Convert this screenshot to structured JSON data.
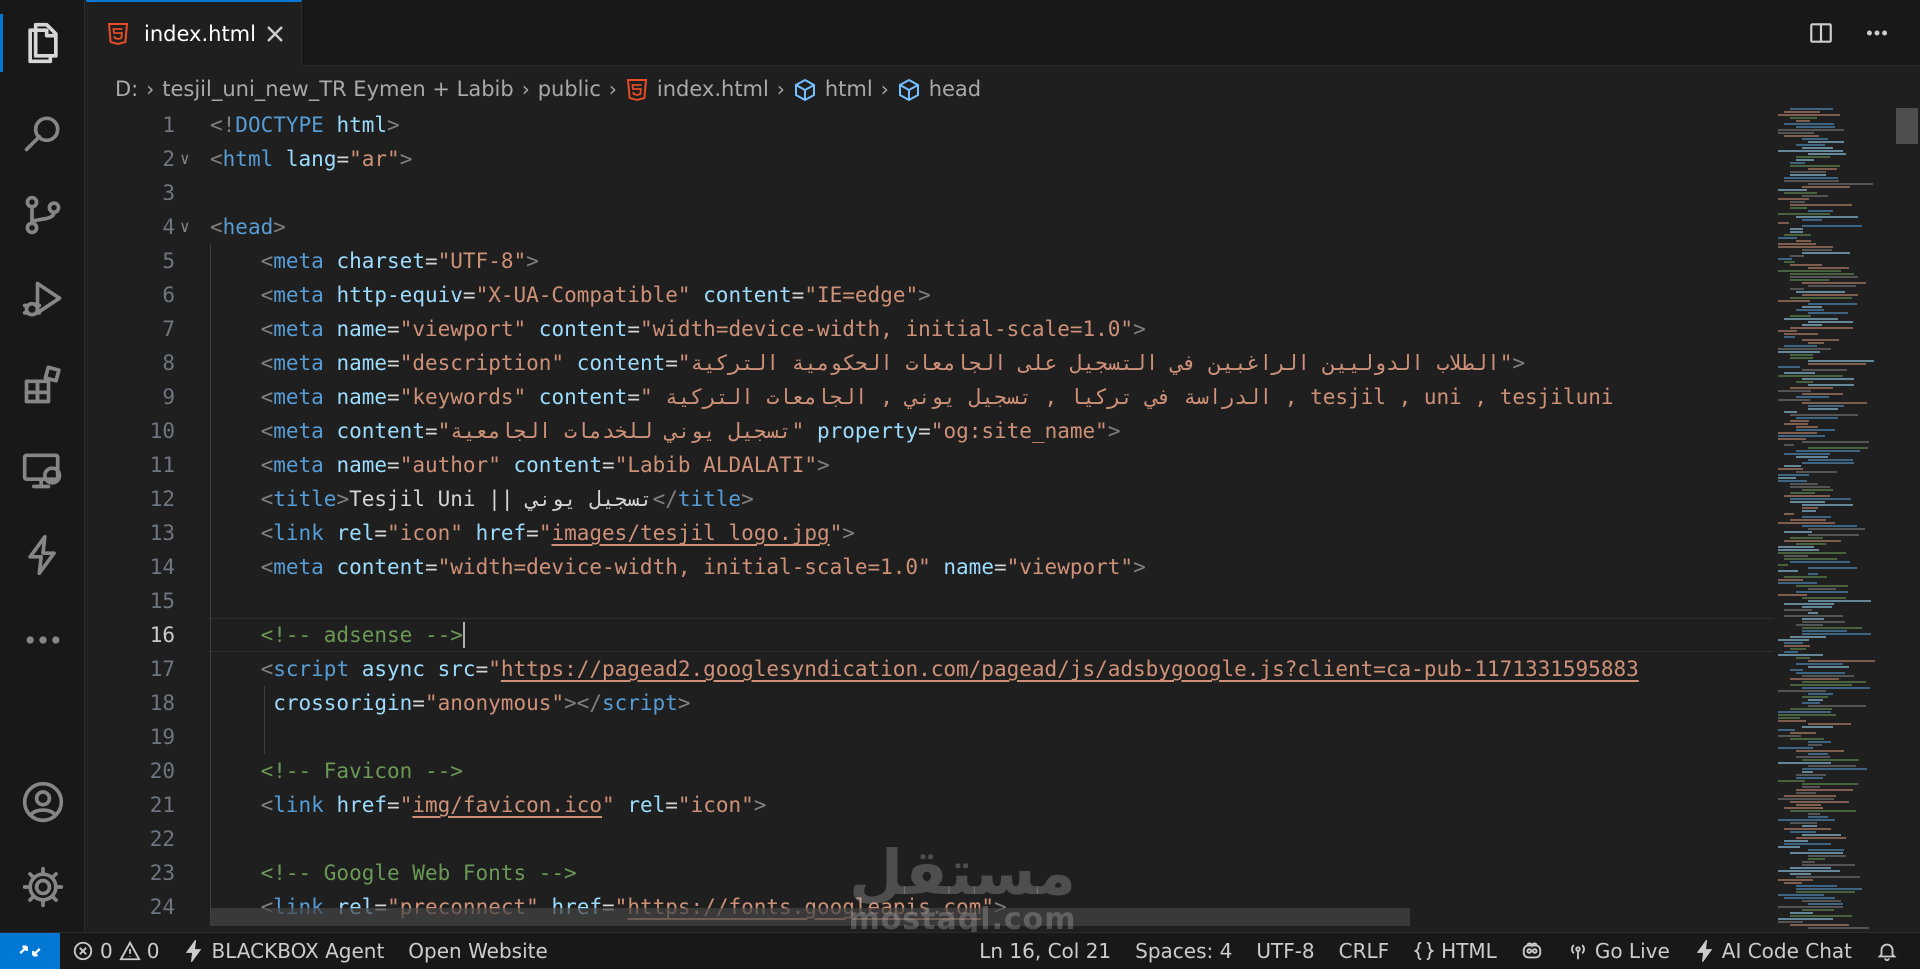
{
  "tab": {
    "label": "index.html"
  },
  "breadcrumb": {
    "items": [
      "D:",
      "tesjil_uni_new_TR Eymen + Labib",
      "public",
      "index.html",
      "html",
      "head"
    ]
  },
  "editor": {
    "current_line": 16,
    "lines": [
      {
        "n": "1",
        "tokens": [
          [
            "p",
            "<!"
          ],
          [
            "t",
            "DOCTYPE"
          ],
          [
            "d",
            " "
          ],
          [
            "a",
            "html"
          ],
          [
            "p",
            ">"
          ]
        ]
      },
      {
        "n": "2",
        "tokens": [
          [
            "p",
            "<"
          ],
          [
            "t",
            "html"
          ],
          [
            "d",
            " "
          ],
          [
            "a",
            "lang"
          ],
          [
            "d",
            "="
          ],
          [
            "s",
            "\"ar\""
          ],
          [
            "p",
            ">"
          ]
        ]
      },
      {
        "n": "3",
        "tokens": []
      },
      {
        "n": "4",
        "tokens": [
          [
            "p",
            "<"
          ],
          [
            "t",
            "head"
          ],
          [
            "p",
            ">"
          ]
        ]
      },
      {
        "n": "5",
        "tokens": [
          [
            "d",
            "    "
          ],
          [
            "p",
            "<"
          ],
          [
            "t",
            "meta"
          ],
          [
            "d",
            " "
          ],
          [
            "a",
            "charset"
          ],
          [
            "d",
            "="
          ],
          [
            "s",
            "\"UTF-8\""
          ],
          [
            "p",
            ">"
          ]
        ]
      },
      {
        "n": "6",
        "tokens": [
          [
            "d",
            "    "
          ],
          [
            "p",
            "<"
          ],
          [
            "t",
            "meta"
          ],
          [
            "d",
            " "
          ],
          [
            "a",
            "http-equiv"
          ],
          [
            "d",
            "="
          ],
          [
            "s",
            "\"X-UA-Compatible\""
          ],
          [
            "d",
            " "
          ],
          [
            "a",
            "content"
          ],
          [
            "d",
            "="
          ],
          [
            "s",
            "\"IE=edge\""
          ],
          [
            "p",
            ">"
          ]
        ]
      },
      {
        "n": "7",
        "tokens": [
          [
            "d",
            "    "
          ],
          [
            "p",
            "<"
          ],
          [
            "t",
            "meta"
          ],
          [
            "d",
            " "
          ],
          [
            "a",
            "name"
          ],
          [
            "d",
            "="
          ],
          [
            "s",
            "\"viewport\""
          ],
          [
            "d",
            " "
          ],
          [
            "a",
            "content"
          ],
          [
            "d",
            "="
          ],
          [
            "s",
            "\"width=device-width, initial-scale=1.0\""
          ],
          [
            "p",
            ">"
          ]
        ]
      },
      {
        "n": "8",
        "tokens": [
          [
            "d",
            "    "
          ],
          [
            "p",
            "<"
          ],
          [
            "t",
            "meta"
          ],
          [
            "d",
            " "
          ],
          [
            "a",
            "name"
          ],
          [
            "d",
            "="
          ],
          [
            "s",
            "\"description\""
          ],
          [
            "d",
            " "
          ],
          [
            "a",
            "content"
          ],
          [
            "d",
            "="
          ],
          [
            "s",
            "\"الطلاب الدوليين الراغبين في التسجيل على الجامعات الحكومية التركية\""
          ],
          [
            "p",
            ">"
          ]
        ]
      },
      {
        "n": "9",
        "tokens": [
          [
            "d",
            "    "
          ],
          [
            "p",
            "<"
          ],
          [
            "t",
            "meta"
          ],
          [
            "d",
            " "
          ],
          [
            "a",
            "name"
          ],
          [
            "d",
            "="
          ],
          [
            "s",
            "\"keywords\""
          ],
          [
            "d",
            " "
          ],
          [
            "a",
            "content"
          ],
          [
            "d",
            "="
          ],
          [
            "s",
            "\" الدراسة في تركيا , تسجيل يوني , الجامعات التركية , tesjil , uni , tesjiluni"
          ]
        ]
      },
      {
        "n": "10",
        "tokens": [
          [
            "d",
            "    "
          ],
          [
            "p",
            "<"
          ],
          [
            "t",
            "meta"
          ],
          [
            "d",
            " "
          ],
          [
            "a",
            "content"
          ],
          [
            "d",
            "="
          ],
          [
            "s",
            "\"تسجيل يوني للخدمات الجامعية\""
          ],
          [
            "d",
            " "
          ],
          [
            "a",
            "property"
          ],
          [
            "d",
            "="
          ],
          [
            "s",
            "\"og:site_name\""
          ],
          [
            "p",
            ">"
          ]
        ]
      },
      {
        "n": "11",
        "tokens": [
          [
            "d",
            "    "
          ],
          [
            "p",
            "<"
          ],
          [
            "t",
            "meta"
          ],
          [
            "d",
            " "
          ],
          [
            "a",
            "name"
          ],
          [
            "d",
            "="
          ],
          [
            "s",
            "\"author\""
          ],
          [
            "d",
            " "
          ],
          [
            "a",
            "content"
          ],
          [
            "d",
            "="
          ],
          [
            "s",
            "\"Labib ALDALATI\""
          ],
          [
            "p",
            ">"
          ]
        ]
      },
      {
        "n": "12",
        "tokens": [
          [
            "d",
            "    "
          ],
          [
            "p",
            "<"
          ],
          [
            "t",
            "title"
          ],
          [
            "p",
            ">"
          ],
          [
            "d",
            "Tesjil Uni || تسجيل يوني"
          ],
          [
            "p",
            "</"
          ],
          [
            "t",
            "title"
          ],
          [
            "p",
            ">"
          ]
        ]
      },
      {
        "n": "13",
        "tokens": [
          [
            "d",
            "    "
          ],
          [
            "p",
            "<"
          ],
          [
            "t",
            "link"
          ],
          [
            "d",
            " "
          ],
          [
            "a",
            "rel"
          ],
          [
            "d",
            "="
          ],
          [
            "s",
            "\"icon\""
          ],
          [
            "d",
            " "
          ],
          [
            "a",
            "href"
          ],
          [
            "d",
            "="
          ],
          [
            "s",
            "\""
          ],
          [
            "su",
            "images/tesjil_logo.jpg"
          ],
          [
            "s",
            "\""
          ],
          [
            "p",
            ">"
          ]
        ]
      },
      {
        "n": "14",
        "tokens": [
          [
            "d",
            "    "
          ],
          [
            "p",
            "<"
          ],
          [
            "t",
            "meta"
          ],
          [
            "d",
            " "
          ],
          [
            "a",
            "content"
          ],
          [
            "d",
            "="
          ],
          [
            "s",
            "\"width=device-width, initial-scale=1.0\""
          ],
          [
            "d",
            " "
          ],
          [
            "a",
            "name"
          ],
          [
            "d",
            "="
          ],
          [
            "s",
            "\"viewport\""
          ],
          [
            "p",
            ">"
          ]
        ]
      },
      {
        "n": "15",
        "tokens": []
      },
      {
        "n": "16",
        "tokens": [
          [
            "d",
            "    "
          ],
          [
            "c",
            "<!-- adsense -->"
          ]
        ]
      },
      {
        "n": "17",
        "tokens": [
          [
            "d",
            "    "
          ],
          [
            "p",
            "<"
          ],
          [
            "t",
            "script"
          ],
          [
            "d",
            " "
          ],
          [
            "a",
            "async"
          ],
          [
            "d",
            " "
          ],
          [
            "a",
            "src"
          ],
          [
            "d",
            "="
          ],
          [
            "s",
            "\""
          ],
          [
            "su",
            "https://pagead2.googlesyndication.com/pagead/js/adsbygoogle.js?client=ca-pub-1171331595883"
          ]
        ]
      },
      {
        "n": "18",
        "tokens": [
          [
            "d",
            "     "
          ],
          [
            "a",
            "crossorigin"
          ],
          [
            "d",
            "="
          ],
          [
            "s",
            "\"anonymous\""
          ],
          [
            "p",
            "></"
          ],
          [
            "t",
            "script"
          ],
          [
            "p",
            ">"
          ]
        ]
      },
      {
        "n": "19",
        "tokens": []
      },
      {
        "n": "20",
        "tokens": [
          [
            "d",
            "    "
          ],
          [
            "c",
            "<!-- Favicon -->"
          ]
        ]
      },
      {
        "n": "21",
        "tokens": [
          [
            "d",
            "    "
          ],
          [
            "p",
            "<"
          ],
          [
            "t",
            "link"
          ],
          [
            "d",
            " "
          ],
          [
            "a",
            "href"
          ],
          [
            "d",
            "="
          ],
          [
            "s",
            "\""
          ],
          [
            "su",
            "img/favicon.ico"
          ],
          [
            "s",
            "\""
          ],
          [
            "d",
            " "
          ],
          [
            "a",
            "rel"
          ],
          [
            "d",
            "="
          ],
          [
            "s",
            "\"icon\""
          ],
          [
            "p",
            ">"
          ]
        ]
      },
      {
        "n": "22",
        "tokens": []
      },
      {
        "n": "23",
        "tokens": [
          [
            "d",
            "    "
          ],
          [
            "c",
            "<!-- Google Web Fonts -->"
          ]
        ]
      },
      {
        "n": "24",
        "tokens": [
          [
            "d",
            "    "
          ],
          [
            "p",
            "<"
          ],
          [
            "t",
            "link"
          ],
          [
            "d",
            " "
          ],
          [
            "a",
            "rel"
          ],
          [
            "d",
            "="
          ],
          [
            "s",
            "\"preconnect\""
          ],
          [
            "d",
            " "
          ],
          [
            "a",
            "href"
          ],
          [
            "d",
            "="
          ],
          [
            "s",
            "\""
          ],
          [
            "su",
            "https://fonts.googleapis.com"
          ],
          [
            "s",
            "\""
          ],
          [
            "p",
            ">"
          ]
        ]
      }
    ]
  },
  "status": {
    "errors": "0",
    "warnings": "0",
    "blackbox": "BLACKBOX Agent",
    "open_website": "Open Website",
    "position": "Ln 16, Col 21",
    "spaces": "Spaces: 4",
    "encoding": "UTF-8",
    "eol": "CRLF",
    "language": "HTML",
    "golive": "Go Live",
    "ai_chat": "AI Code Chat"
  },
  "watermark": {
    "arabic": "مستقل",
    "latin": "mostaql.com"
  },
  "colors": {
    "accent": "#0078d4",
    "tag": "#569cd6",
    "attr": "#9cdcfe",
    "string": "#ce9178",
    "comment": "#6a9955",
    "html5": "#e44d26"
  },
  "icons": [
    "explorer-icon",
    "search-icon",
    "source-control-icon",
    "run-debug-icon",
    "extensions-icon",
    "remote-explorer-icon",
    "blackbox-icon",
    "more-icon",
    "account-icon",
    "settings-gear-icon",
    "html5-icon",
    "close-icon",
    "split-editor-icon",
    "more-actions-icon",
    "symbol-cube-icon",
    "remote-icon",
    "error-icon",
    "warning-icon",
    "lightning-icon",
    "braces-icon",
    "copilot-icon",
    "broadcast-icon",
    "bell-icon"
  ]
}
